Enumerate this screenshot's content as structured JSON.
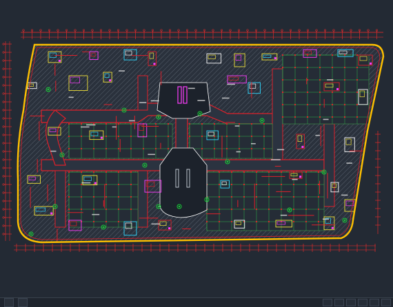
{
  "app": {
    "viewport_background": "#232a34"
  },
  "drawing": {
    "subject": "commercial-floor-plan",
    "colors": {
      "outline": "#ffc000",
      "wall": "#e0202a",
      "dimension": "#ff2a2a",
      "grid": "#ff3030",
      "hatch": "#5d6672",
      "corridor_fill": "#2b3340",
      "greenery": "#18d238",
      "equipment_magenta": "#ff3cff",
      "equipment_yellow": "#f2e33a",
      "equipment_cyan": "#30d8ff",
      "atrium_fill": "#1c222b",
      "atrium_outline": "#ffffff"
    },
    "icons": [
      "tree-icon",
      "escalator-icon",
      "stair-icon",
      "column-icon"
    ]
  },
  "statusbar": {
    "tabs": [
      "",
      ""
    ],
    "buttons": 6
  }
}
